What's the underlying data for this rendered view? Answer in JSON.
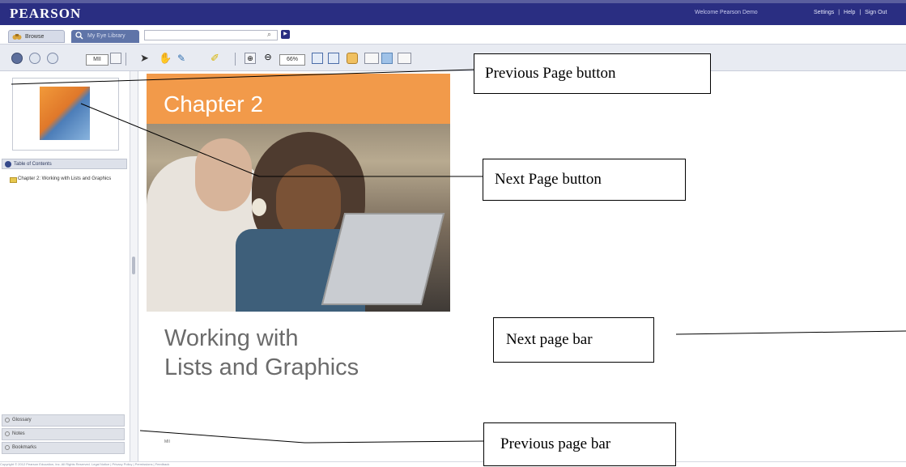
{
  "header": {
    "brand": "PEARSON",
    "welcome_text": "Welcome Pearson Demo",
    "links": [
      "Settings",
      "|",
      "Help",
      "|",
      "Sign Out"
    ]
  },
  "tabs": {
    "browse_label": "Browse",
    "search_label": "My Eye Library"
  },
  "toolbar": {
    "page_value": "MII",
    "zoom_value": "66%"
  },
  "sidebar": {
    "toc_header": "Table of Contents",
    "toc_item": "Chapter 2: Working with Lists and Graphics",
    "panels": [
      "Glossary",
      "Notes",
      "Bookmarks"
    ]
  },
  "page": {
    "chapter_title": "Chapter 2",
    "subtitle_line1": "Working with",
    "subtitle_line2": "Lists and Graphics",
    "page_number": "MII"
  },
  "footer": {
    "text": "Copyright © 2012 Pearson Education, Inc. All Rights Reserved.   Legal Notice  |  Privacy Policy  |  Permissions  |  Feedback"
  },
  "callouts": {
    "previous_page_button": "Previous Page button",
    "next_page_button": "Next Page button",
    "next_page_bar": "Next page bar",
    "previous_page_bar": "Previous page bar"
  },
  "colors": {
    "brand_bar": "#2a2e82",
    "chapter_band": "#f29a4a",
    "toolbar_bg": "#e8ebf2"
  }
}
